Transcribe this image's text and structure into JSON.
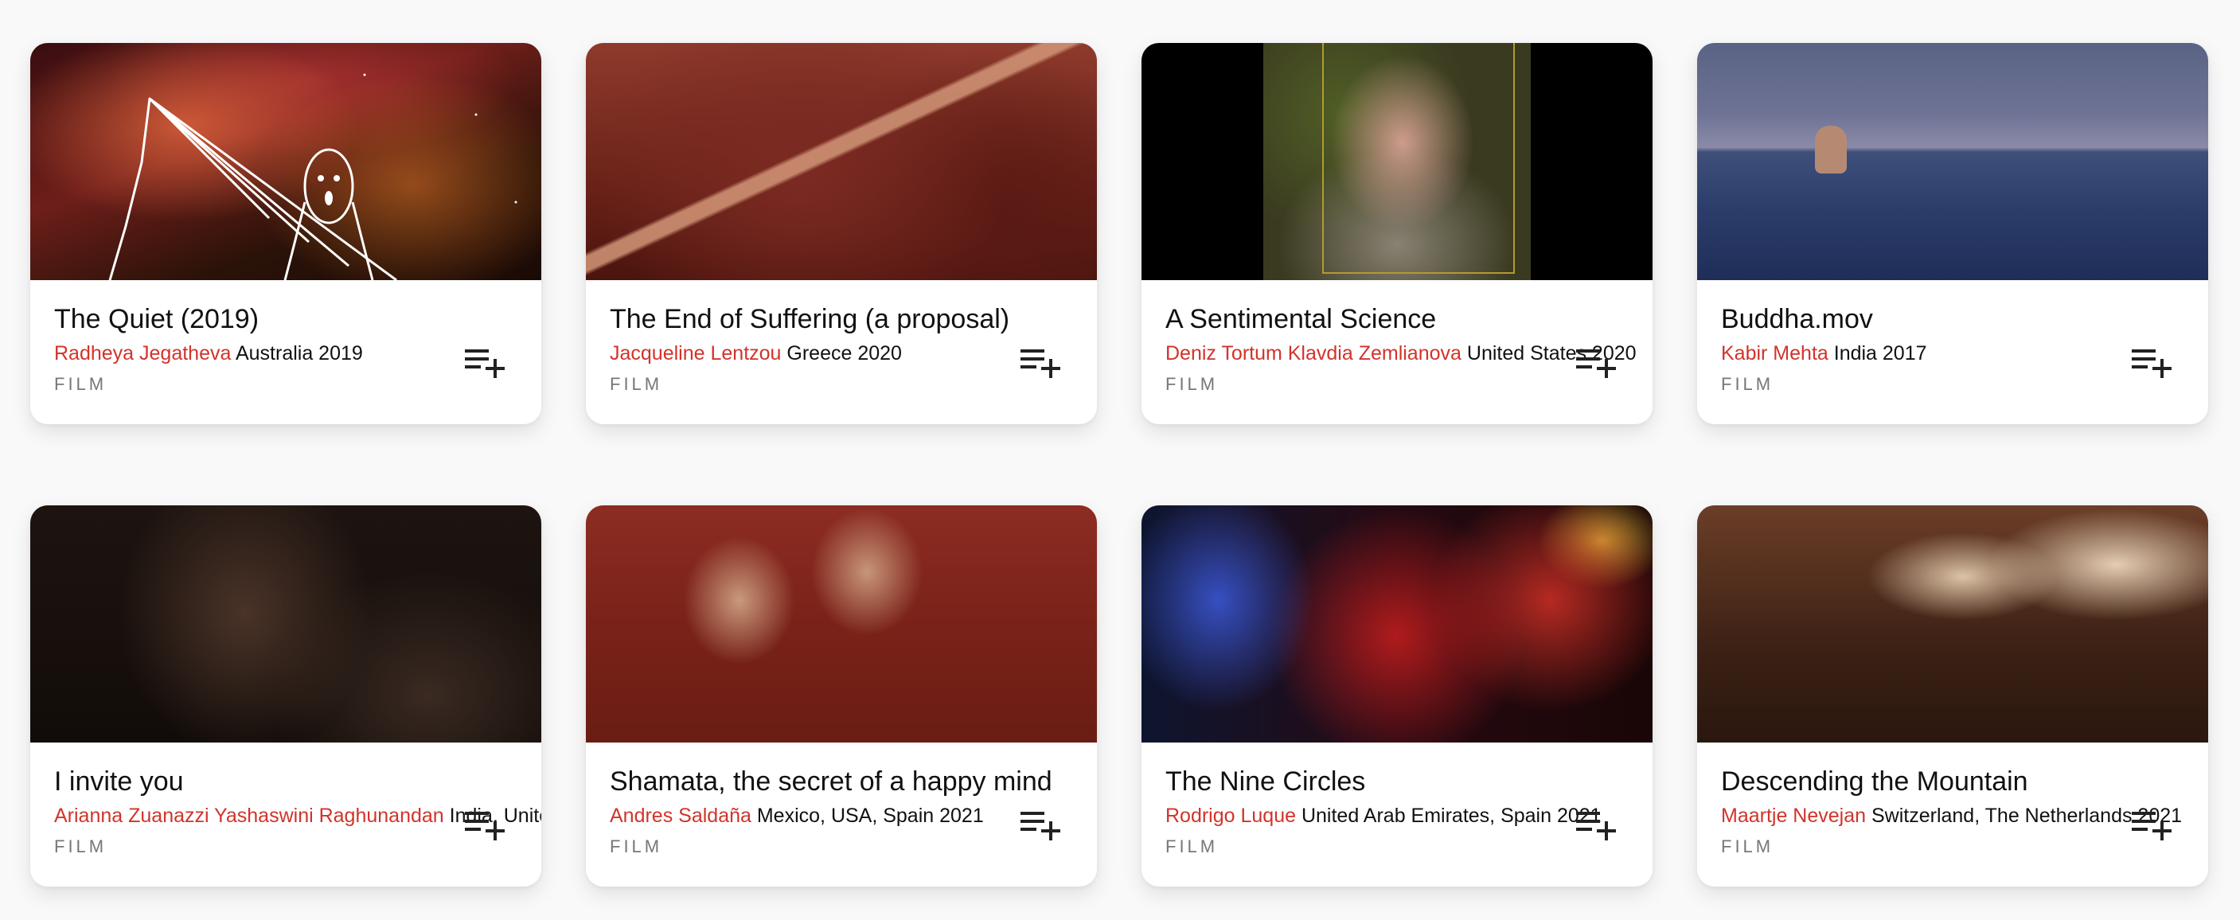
{
  "colors": {
    "accent": "#d2332a",
    "text": "#111111",
    "muted": "#777777",
    "background": "#f9f9fa"
  },
  "add_icon": "playlist-add-icon",
  "cards": [
    {
      "title": "The Quiet (2019)",
      "authors": "Radheya Jegatheva",
      "details": "Australia 2019",
      "type": "FILM"
    },
    {
      "title": "The End of Suffering (a proposal)",
      "authors": "Jacqueline Lentzou",
      "details": "Greece 2020",
      "type": "FILM"
    },
    {
      "title": "A Sentimental Science",
      "authors": "Deniz Tortum Klavdia Zemlianova",
      "details": "United States 2020",
      "type": "FILM"
    },
    {
      "title": "Buddha.mov",
      "authors": "Kabir Mehta",
      "details": "India 2017",
      "type": "FILM"
    },
    {
      "title": "I invite you",
      "authors": "Arianna Zuanazzi Yashaswini Raghunandan",
      "details": "India, United",
      "type": "FILM"
    },
    {
      "title": "Shamata, the secret of a happy mind",
      "authors": "Andres Saldaña",
      "details": "Mexico, USA, Spain 2021",
      "type": "FILM"
    },
    {
      "title": "The Nine Circles",
      "authors": "Rodrigo Luque",
      "details": "United Arab Emirates, Spain 2021",
      "type": "FILM"
    },
    {
      "title": "Descending the Mountain",
      "authors": "Maartje Nevejan",
      "details": "Switzerland, The Netherlands 2021",
      "type": "FILM"
    }
  ]
}
